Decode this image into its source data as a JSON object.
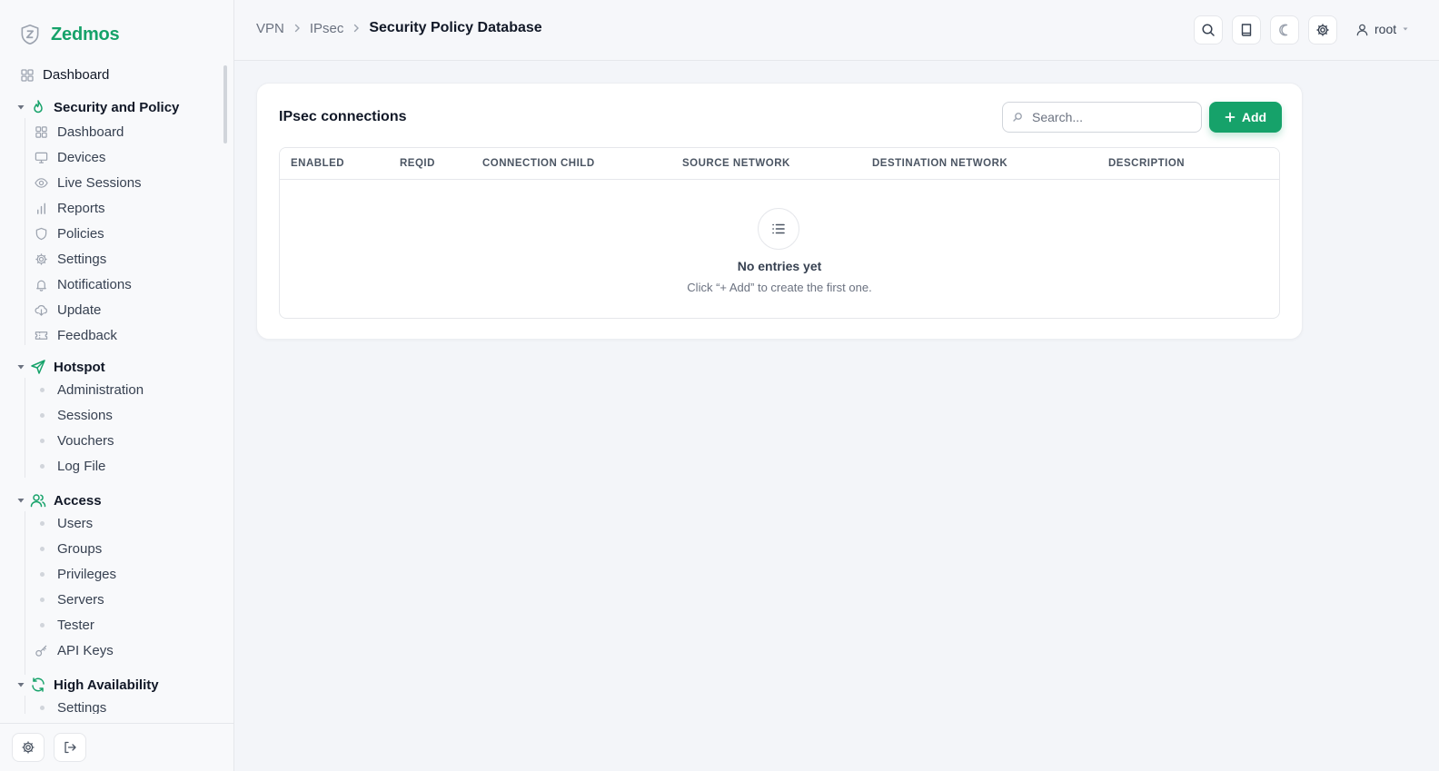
{
  "brand": {
    "name": "Zedmos",
    "logo_icon": "shield-z-icon",
    "accent": "#16a26a"
  },
  "sidebar": {
    "top_item": {
      "label": "Dashboard",
      "icon": "grid-icon"
    },
    "groups": [
      {
        "label": "Security and Policy",
        "icon": "flame-icon",
        "items": [
          {
            "label": "Dashboard",
            "icon": "grid-icon"
          },
          {
            "label": "Devices",
            "icon": "monitor-icon"
          },
          {
            "label": "Live Sessions",
            "icon": "eye-icon"
          },
          {
            "label": "Reports",
            "icon": "bar-chart-icon"
          },
          {
            "label": "Policies",
            "icon": "shield-icon"
          },
          {
            "label": "Settings",
            "icon": "gear-icon"
          },
          {
            "label": "Notifications",
            "icon": "bell-icon"
          },
          {
            "label": "Update",
            "icon": "cloud-download-icon"
          },
          {
            "label": "Feedback",
            "icon": "ticket-icon"
          }
        ]
      },
      {
        "label": "Hotspot",
        "icon": "send-icon",
        "items": [
          {
            "label": "Administration"
          },
          {
            "label": "Sessions"
          },
          {
            "label": "Vouchers"
          },
          {
            "label": "Log File"
          }
        ]
      },
      {
        "label": "Access",
        "icon": "users-icon",
        "items": [
          {
            "label": "Users"
          },
          {
            "label": "Groups"
          },
          {
            "label": "Privileges"
          },
          {
            "label": "Servers"
          },
          {
            "label": "Tester"
          },
          {
            "label": "API Keys",
            "icon": "key-icon"
          }
        ]
      },
      {
        "label": "High Availability",
        "icon": "refresh-icon",
        "items": [
          {
            "label": "Settings"
          }
        ]
      }
    ],
    "footer": {
      "settings_icon": "gear-icon",
      "logout_icon": "logout-icon"
    }
  },
  "topbar": {
    "breadcrumbs": [
      "VPN",
      "IPsec",
      "Security Policy Database"
    ],
    "icons": [
      "search-icon",
      "book-icon",
      "moon-icon",
      "gear-icon"
    ],
    "user": {
      "name": "root",
      "icon": "user-icon"
    }
  },
  "card": {
    "title": "IPsec connections",
    "search_placeholder": "Search...",
    "add_label": "Add",
    "columns": [
      "ENABLED",
      "REQID",
      "CONNECTION CHILD",
      "SOURCE NETWORK",
      "DESTINATION NETWORK",
      "DESCRIPTION"
    ],
    "rows": [],
    "empty": {
      "icon": "list-icon",
      "title": "No entries yet",
      "subtitle": "Click “+ Add” to create the first one."
    }
  }
}
